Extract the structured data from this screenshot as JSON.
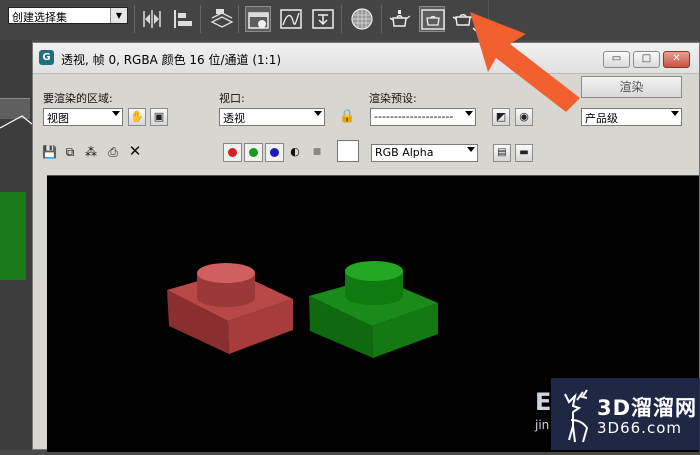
{
  "toolbar": {
    "selection_set": "创建选择集"
  },
  "window": {
    "title": "透视, 帧 0, RGBA 颜色 16 位/通道 (1:1)",
    "minimize": "▭",
    "maximize": "□",
    "close": "✕"
  },
  "controls": {
    "area_label": "要渲染的区域:",
    "area_value": "视图",
    "viewport_label": "视口:",
    "viewport_value": "透视",
    "preset_label": "渲染预设:",
    "preset_value": "--------------------",
    "render_button": "渲染",
    "quality_value": "产品级",
    "channel_value": "RGB Alpha"
  },
  "watermark": {
    "logo": "3D溜溜网",
    "url": "3D66.com",
    "partial_logo": "E",
    "partial_url": "jin"
  },
  "colors": {
    "red_channel": "#d42020",
    "green_channel": "#1a9a1a",
    "blue_channel": "#1a1ab8",
    "arrow": "#f2602f"
  }
}
